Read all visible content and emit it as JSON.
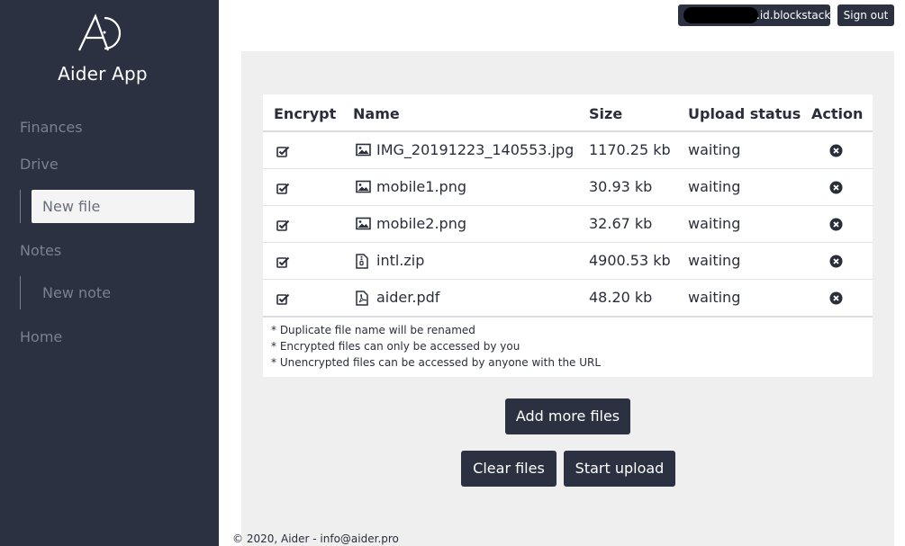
{
  "app": {
    "title": "Aider App"
  },
  "sidebar": {
    "finances": "Finances",
    "drive": "Drive",
    "new_file": "New file",
    "notes": "Notes",
    "new_note": "New note",
    "home": "Home"
  },
  "header": {
    "username_suffix": ".id.blockstack",
    "signout": "Sign out"
  },
  "table": {
    "headers": {
      "encrypt": "Encrypt",
      "name": "Name",
      "size": "Size",
      "status": "Upload status",
      "action": "Action"
    },
    "rows": [
      {
        "encrypted": true,
        "icon": "image-file-icon",
        "name": "IMG_20191223_140553.jpg",
        "size": "1170.25 kb",
        "status": "waiting"
      },
      {
        "encrypted": true,
        "icon": "image-file-icon",
        "name": "mobile1.png",
        "size": "30.93 kb",
        "status": "waiting"
      },
      {
        "encrypted": true,
        "icon": "image-file-icon",
        "name": "mobile2.png",
        "size": "32.67 kb",
        "status": "waiting"
      },
      {
        "encrypted": true,
        "icon": "zip-file-icon",
        "name": "intl.zip",
        "size": "4900.53 kb",
        "status": "waiting"
      },
      {
        "encrypted": true,
        "icon": "pdf-file-icon",
        "name": "aider.pdf",
        "size": "48.20 kb",
        "status": "waiting"
      }
    ]
  },
  "notes": [
    "* Duplicate file name will be renamed",
    "* Encrypted files can only be accessed by you",
    "* Unencrypted files can be accessed by anyone with the URL"
  ],
  "buttons": {
    "add_more": "Add more files",
    "clear": "Clear files",
    "start": "Start upload"
  },
  "footer": "© 2020, Aider - info@aider.pro",
  "colors": {
    "sidebar_bg": "#2c3142",
    "panel_bg": "#efefef",
    "nav_text": "#7b8091"
  }
}
